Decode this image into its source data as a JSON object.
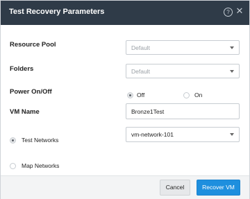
{
  "dialog": {
    "title": "Test Recovery Parameters",
    "help_icon": "?"
  },
  "resource_pool": {
    "label": "Resource Pool",
    "value": "Default"
  },
  "folders": {
    "label": "Folders",
    "value": "Default"
  },
  "power": {
    "label": "Power On/Off",
    "options": [
      "Off",
      "On"
    ],
    "selected": "Off"
  },
  "vm_name": {
    "label": "VM Name",
    "value": "Bronze1Test"
  },
  "networks": {
    "options": [
      "Test Networks",
      "Map Networks"
    ],
    "selected": "Test Networks",
    "test_network_value": "vm-network-101"
  },
  "footer": {
    "cancel_label": "Cancel",
    "recover_label": "Recover VM"
  },
  "colors": {
    "titlebar": "#2f3b48",
    "primary": "#1e8fde"
  }
}
